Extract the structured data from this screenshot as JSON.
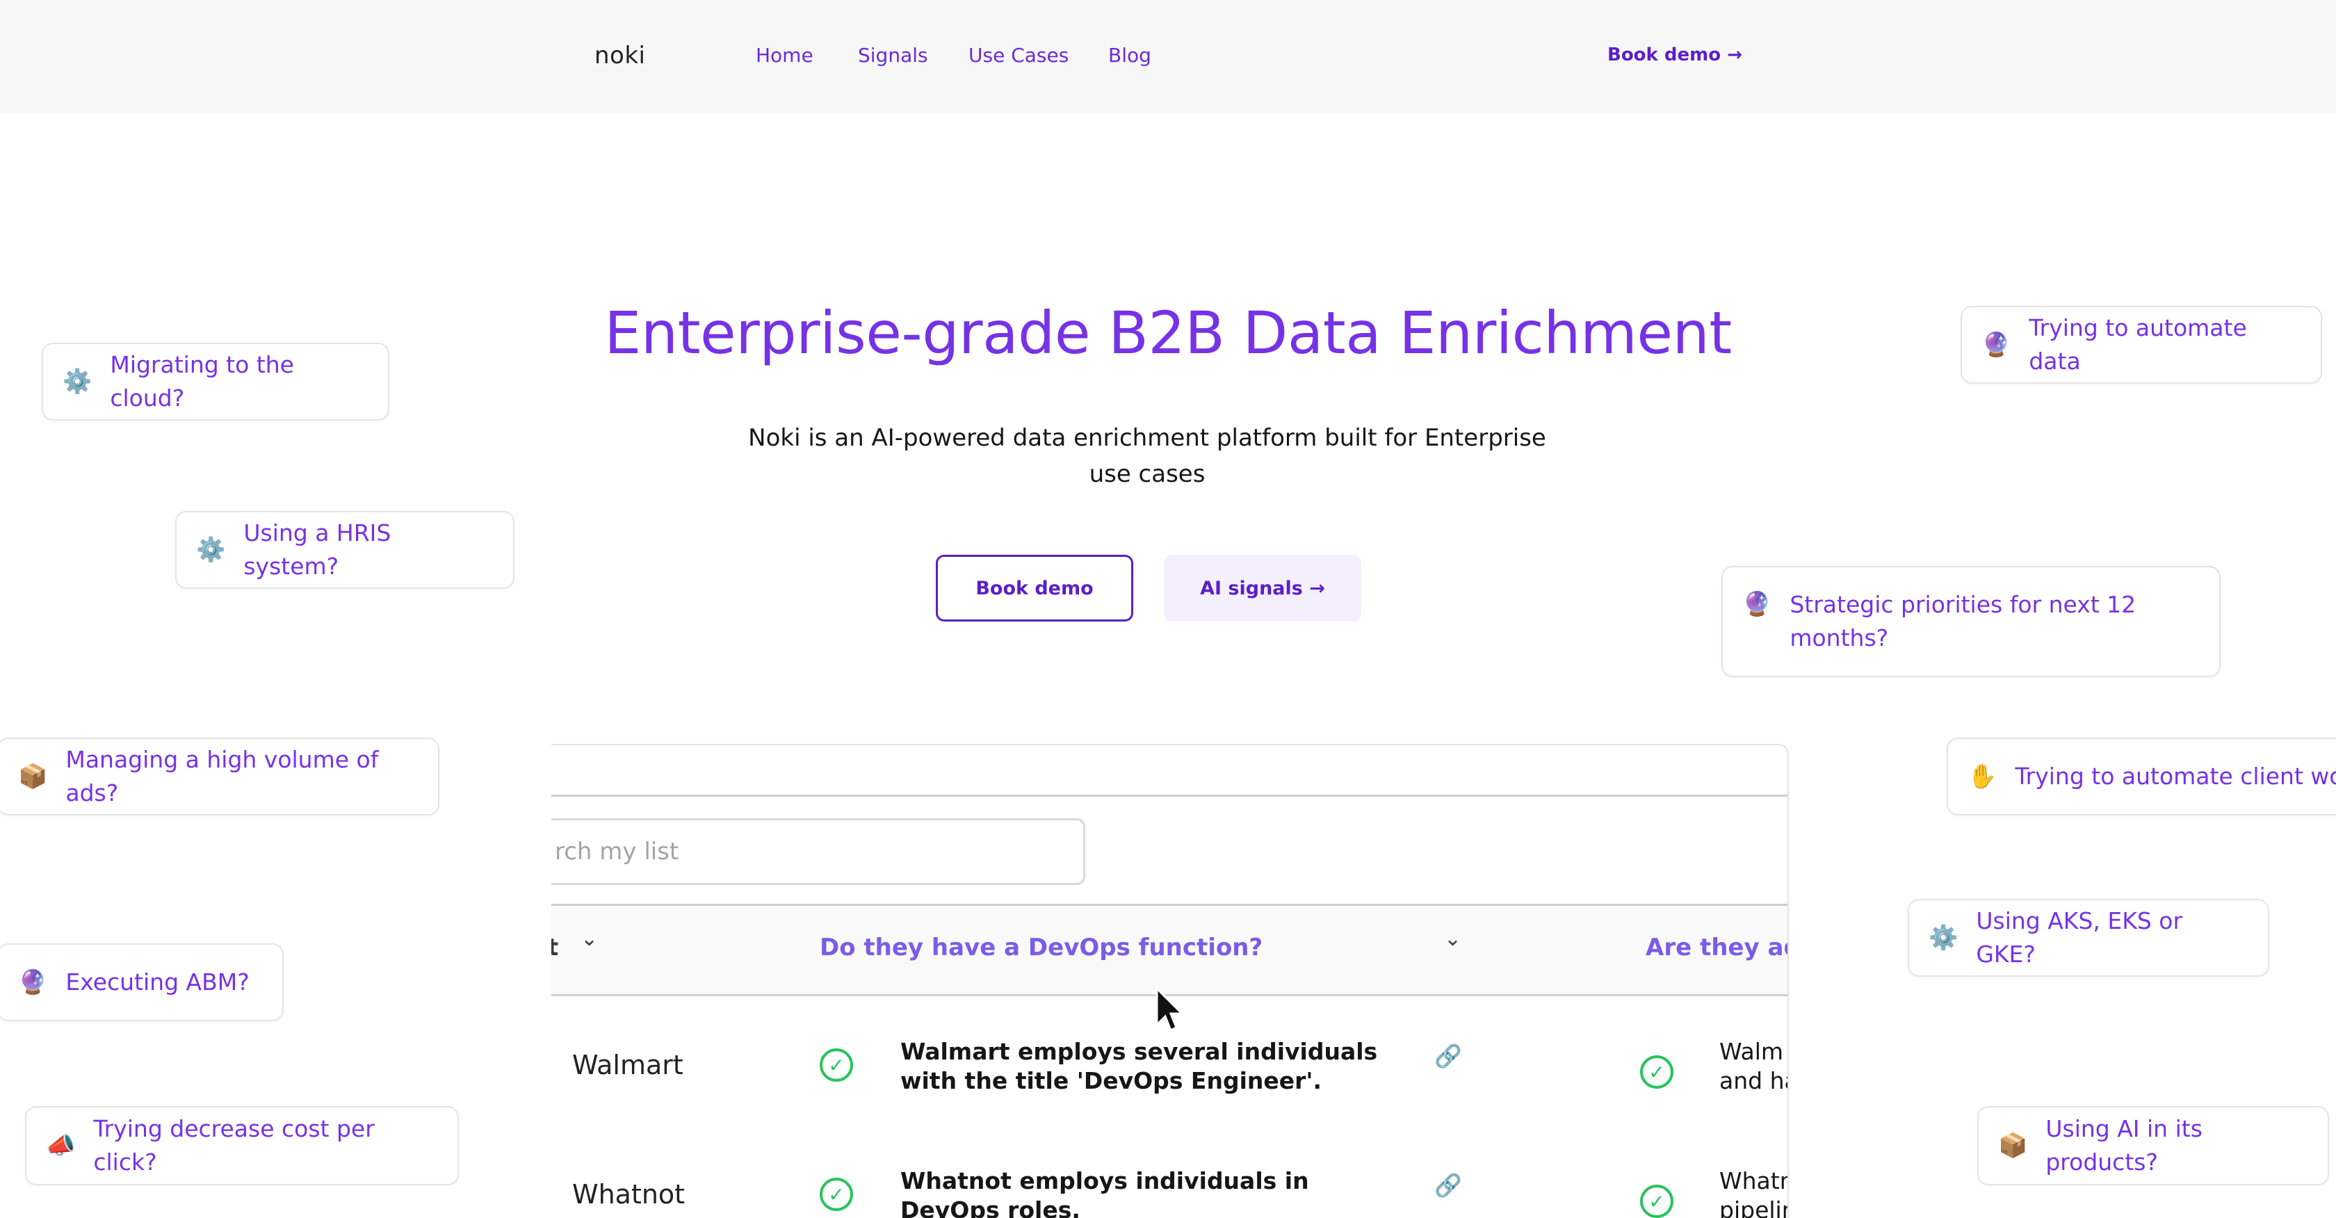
{
  "nav": {
    "logo": "noki",
    "links": [
      "Home",
      "Signals",
      "Use Cases",
      "Blog"
    ],
    "book_demo": "Book demo →"
  },
  "hero": {
    "title": "Enterprise-grade B2B Data Enrichment",
    "subtitle": "Noki is an AI-powered data enrichment platform built for Enterprise use cases",
    "primary_button": "Book demo",
    "secondary_button": "AI signals →"
  },
  "chips": [
    {
      "icon": "⚙️",
      "text": "Migrating to the cloud?"
    },
    {
      "icon": "⚙️",
      "text": "Using a HRIS system?"
    },
    {
      "icon": "📦",
      "text": "Managing a high volume of ads?"
    },
    {
      "icon": "🔮",
      "text": "Executing ABM?"
    },
    {
      "icon": "📣",
      "text": "Trying decrease cost per click?"
    },
    {
      "icon": "🔮",
      "text": "Trying to automate data"
    },
    {
      "icon": "🔮",
      "text": "Strategic priorities for next 12 months?"
    },
    {
      "icon": "✋",
      "text": "Trying to automate client work"
    },
    {
      "icon": "⚙️",
      "text": "Using AKS, EKS or GKE?"
    },
    {
      "icon": "📦",
      "text": "Using AI in its products?"
    }
  ],
  "table": {
    "search_placeholder": "rch my list",
    "first_col_tail": "t",
    "col1_title": "Do they have a DevOps function?",
    "col2_title": "Are they ado",
    "rows": [
      {
        "company": "Walmart",
        "answer": "Walmart employs several individuals with the title 'DevOps Engineer'.",
        "answer2": "Walm and ha"
      },
      {
        "company": "Whatnot",
        "answer": "Whatnot employs individuals in DevOps roles.",
        "answer2": "Whatn pipelin"
      }
    ]
  },
  "icons": {
    "check": "✓",
    "link": "🔗",
    "chevron": "⌄"
  }
}
